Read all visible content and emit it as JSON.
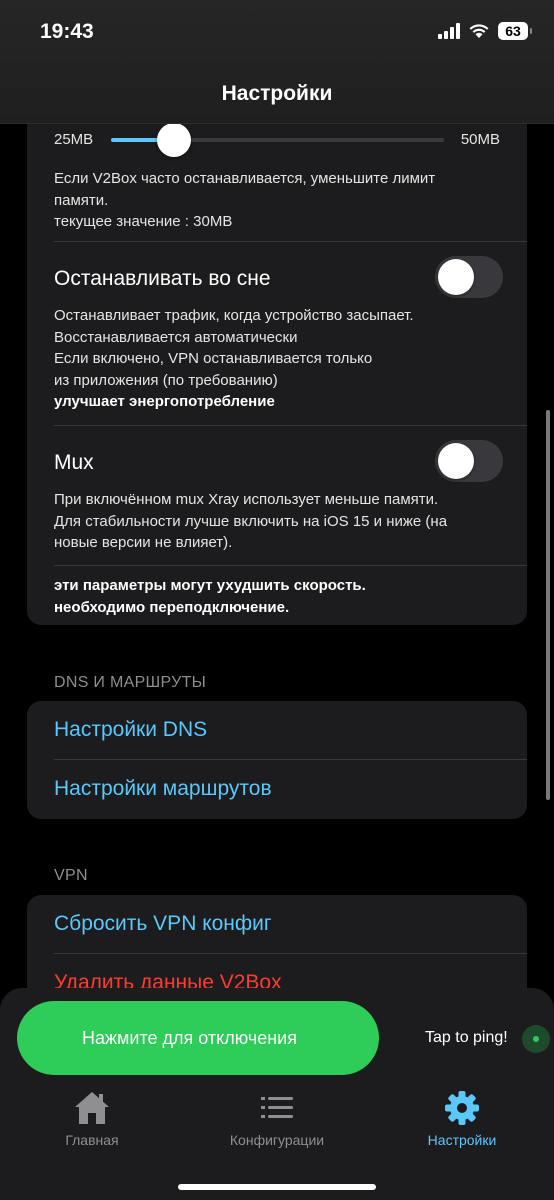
{
  "status_bar": {
    "time": "19:43",
    "battery": "63"
  },
  "header": {
    "title": "Настройки"
  },
  "memory_slider": {
    "min_label": "25MB",
    "max_label": "50MB",
    "fraction": 0.19,
    "description_line1": "Если V2Box часто останавливается, уменьшите лимит",
    "description_line2": "памяти.",
    "current_value": "текущее значение : 30MB"
  },
  "sleep_stop": {
    "label": "Останавливать во сне",
    "enabled": false,
    "desc1": "Останавливает трафик, когда устройство засыпает.",
    "desc2": "Восстанавливается автоматически",
    "desc3": "Если включено, VPN останавливается только",
    "desc4": "из приложения (по требованию)",
    "desc_bold": "улучшает энергопотребление"
  },
  "mux": {
    "label": "Mux",
    "enabled": false,
    "desc1": "При включённом mux Xray использует меньше памяти.",
    "desc2": "Для стабильности лучше включить на iOS 15 и ниже (на",
    "desc3": "новые версии не влияет).",
    "warning1": "эти параметры могут ухудшить скорость.",
    "warning2": "необходимо переподключение."
  },
  "dns_section": {
    "header": "DNS И МАРШРУТЫ",
    "items": [
      "Настройки DNS",
      "Настройки маршрутов"
    ]
  },
  "vpn_section": {
    "header": "VPN",
    "items": [
      "Сбросить VPN конфиг",
      "Удалить данные V2Box"
    ]
  },
  "connection": {
    "button_label": "Нажмите для отключения",
    "ping_label": "Tap to ping!"
  },
  "tabs": [
    {
      "label": "Главная",
      "icon": "home-icon",
      "active": false
    },
    {
      "label": "Конфигурации",
      "icon": "list-icon",
      "active": false
    },
    {
      "label": "Настройки",
      "icon": "gear-icon",
      "active": true
    }
  ],
  "colors": {
    "accent": "#5ac8fa",
    "connect": "#2ecc58",
    "danger": "#ff3b30"
  }
}
